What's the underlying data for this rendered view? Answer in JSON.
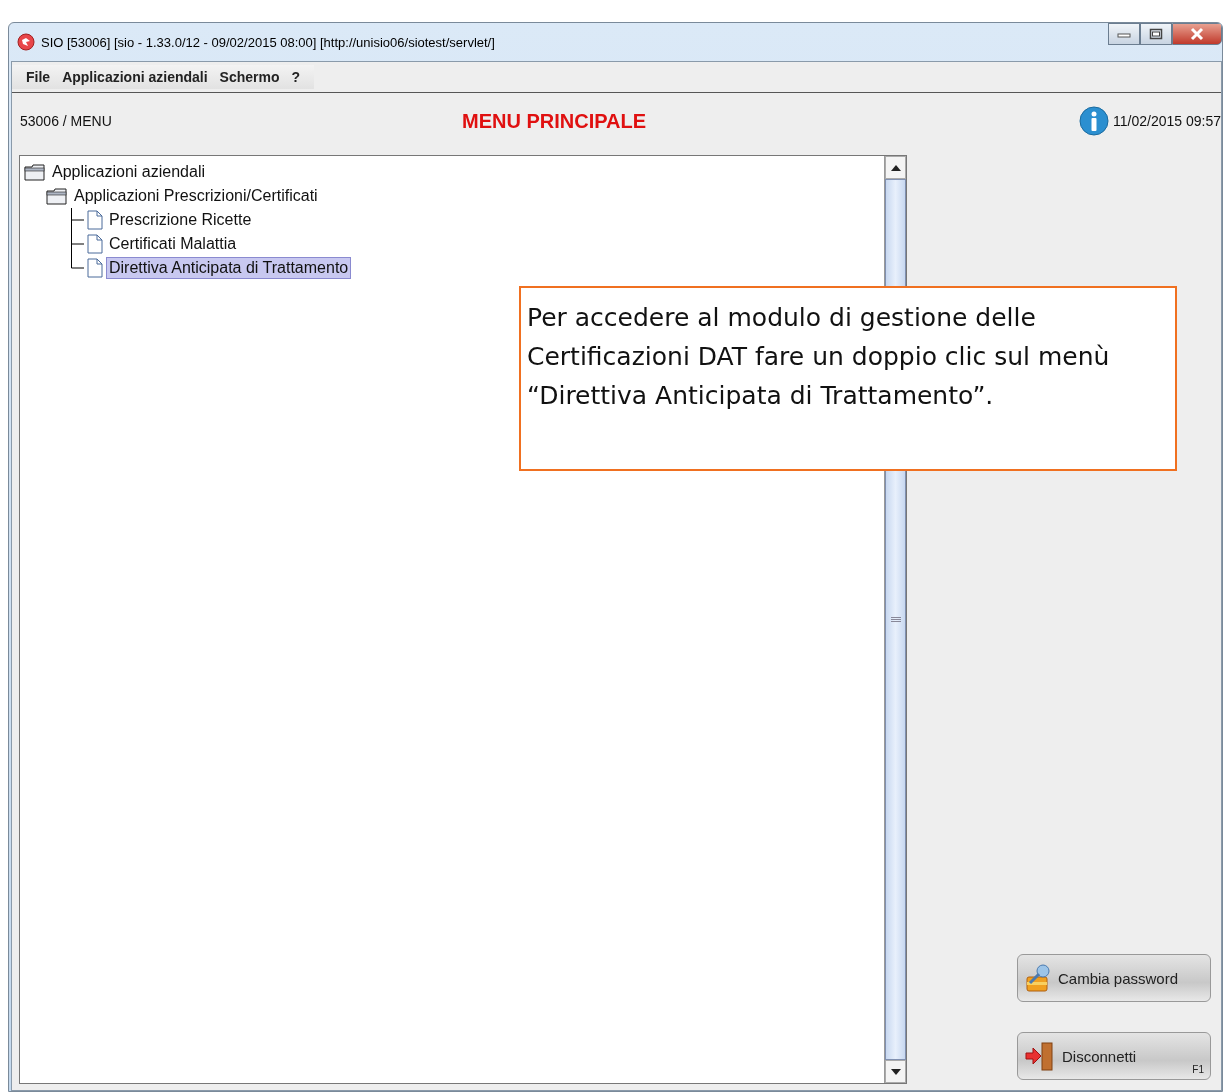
{
  "window": {
    "title": "SIO [53006] [sio - 1.33.0/12 - 09/02/2015 08:00] [http://unisio06/siotest/servlet/]"
  },
  "menu_bar": [
    "File",
    "Applicazioni aziendali",
    "Schermo",
    "?"
  ],
  "header": {
    "path": "53006 / MENU",
    "title": "MENU PRINCIPALE",
    "datetime": "11/02/2015 09:57"
  },
  "tree": [
    {
      "label": "Applicazioni aziendali",
      "kind": "folder",
      "selected": false,
      "children": [
        {
          "label": "Applicazioni Prescrizioni/Certificati",
          "kind": "folder",
          "selected": false,
          "children": [
            {
              "label": "Prescrizione Ricette",
              "kind": "document",
              "selected": false
            },
            {
              "label": "Certificati Malattia",
              "kind": "document",
              "selected": false
            },
            {
              "label": "Direttiva Anticipata di Trattamento",
              "kind": "document",
              "selected": true
            }
          ]
        }
      ]
    }
  ],
  "callout": "Per accedere al modulo di gestione delle Certificazioni DAT fare un doppio clic sul menù “Direttiva Anticipata di Trattamento”.",
  "buttons": [
    {
      "label": "Cambia password",
      "kind": "password"
    },
    {
      "label": "Disconnetti",
      "kind": "logout",
      "shortcut": "F1"
    }
  ]
}
